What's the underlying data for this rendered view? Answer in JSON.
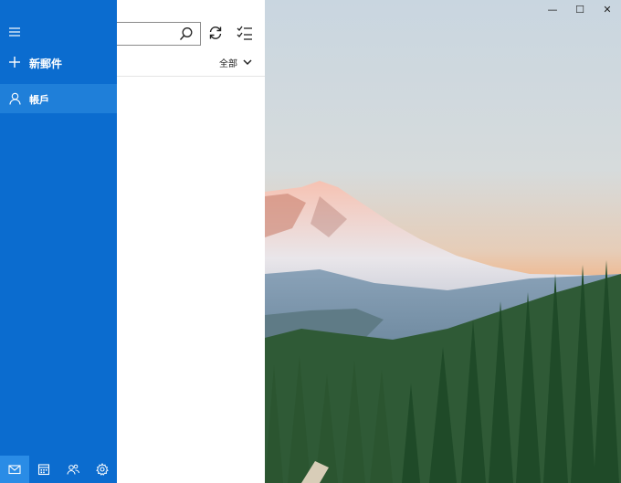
{
  "window": {
    "minimize_glyph": "—",
    "maximize_glyph": "☐",
    "close_glyph": "✕"
  },
  "nav": {
    "new_mail_label": "新郵件",
    "account_label": "帳戶",
    "bottom_icons": [
      "mail-icon",
      "calendar-icon",
      "people-icon",
      "settings-icon"
    ]
  },
  "list": {
    "filter_label": "全部",
    "search_icon": "search-icon",
    "sync_icon": "sync-icon",
    "select_icon": "select-mode-icon"
  },
  "colors": {
    "nav_bg": "#0b6ccf",
    "nav_selected": "#1f7fd9",
    "bottom_active": "#2a8ce6"
  }
}
